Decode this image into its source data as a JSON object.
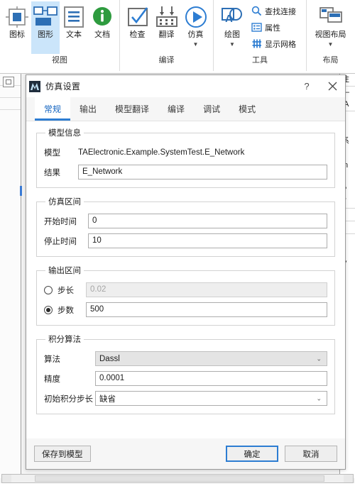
{
  "ribbon": {
    "groups": [
      {
        "label": "视图",
        "buttons": [
          {
            "caption": "图标",
            "icon": "icon-symbol-icon",
            "selected": false,
            "caret": false
          },
          {
            "caption": "图形",
            "icon": "diagram-shapes-icon",
            "selected": true,
            "caret": false
          },
          {
            "caption": "文本",
            "icon": "text-lines-icon",
            "selected": false,
            "caret": false
          },
          {
            "caption": "文档",
            "icon": "info-circle-icon",
            "selected": false,
            "caret": false
          }
        ]
      },
      {
        "label": "编译",
        "buttons": [
          {
            "caption": "检查",
            "icon": "checkmark-box-icon",
            "selected": false,
            "caret": false
          },
          {
            "caption": "翻译",
            "icon": "translate-grid-icon",
            "selected": false,
            "caret": false
          },
          {
            "caption": "仿真",
            "icon": "play-circle-icon",
            "selected": false,
            "caret": true
          }
        ]
      },
      {
        "label": "工具",
        "buttons": [
          {
            "caption": "绘图",
            "icon": "draw-shapes-icon",
            "selected": false,
            "caret": true
          }
        ],
        "small_buttons": [
          {
            "caption": "查找连接",
            "icon": "find-connection-icon"
          },
          {
            "caption": "属性",
            "icon": "properties-list-icon"
          },
          {
            "caption": "显示网格",
            "icon": "show-grid-icon"
          }
        ]
      },
      {
        "label": "布局",
        "buttons": [
          {
            "caption": "视图布局",
            "icon": "view-layout-icon",
            "selected": false,
            "caret": true
          }
        ]
      }
    ]
  },
  "background_panel": {
    "rows": [
      "注",
      "—",
      "[A",
      "≡",
      "Γ",
      "系",
      "",
      "In",
      "",
      "P",
      "T",
      ".",
      ".",
      "",
      "",
      "V",
      "≥"
    ]
  },
  "dialog": {
    "title": "仿真设置",
    "icon": "mworks-app-icon",
    "help_button": "?",
    "close_button": "✕",
    "tabs": [
      {
        "label": "常规",
        "active": true
      },
      {
        "label": "输出",
        "active": false
      },
      {
        "label": "模型翻译",
        "active": false
      },
      {
        "label": "编译",
        "active": false
      },
      {
        "label": "调试",
        "active": false
      },
      {
        "label": "模式",
        "active": false
      }
    ],
    "groups": {
      "model_info": {
        "legend": "模型信息",
        "model_label": "模型",
        "model_value": "TAElectronic.Example.SystemTest.E_Network",
        "result_label": "结果",
        "result_value": "E_Network"
      },
      "sim_interval": {
        "legend": "仿真区间",
        "start_label": "开始时间",
        "start_value": "0",
        "stop_label": "停止时间",
        "stop_value": "10"
      },
      "output_interval": {
        "legend": "输出区间",
        "step_size_label": "步长",
        "step_size_value": "0.02",
        "step_size_selected": false,
        "step_count_label": "步数",
        "step_count_value": "500",
        "step_count_selected": true
      },
      "integration": {
        "legend": "积分算法",
        "algorithm_label": "算法",
        "algorithm_value": "Dassl",
        "tolerance_label": "精度",
        "tolerance_value": "0.0001",
        "initial_step_label": "初始积分步长",
        "initial_step_value": "缺省"
      }
    },
    "footer": {
      "save_to_model": "保存到模型",
      "ok": "确定",
      "cancel": "取消"
    }
  },
  "colors": {
    "accent": "#2d7dd2",
    "tab_active_text": "#1565c0",
    "ribbon_selected_bg": "#cbe5fa",
    "doc_icon_green": "#2e9b3f",
    "dialog_icon_bg": "#1f2d3d"
  }
}
